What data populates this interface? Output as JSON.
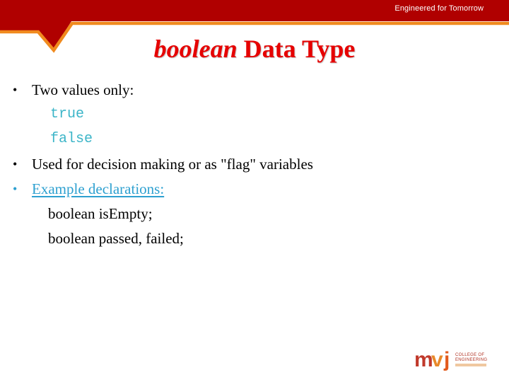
{
  "header": {
    "tagline": "Engineered for Tomorrow",
    "colors": {
      "banner_red": "#b00000",
      "accent_orange": "#f08a1e",
      "title_red": "#e60000"
    }
  },
  "slide": {
    "title_italic": "boolean",
    "title_rest": " Data Type",
    "items": [
      {
        "type": "bullet",
        "text": "Two values only:"
      },
      {
        "type": "code",
        "text": "true"
      },
      {
        "type": "code",
        "text": "false"
      },
      {
        "type": "bullet",
        "text": "Used for decision making or as \"flag\" variables"
      },
      {
        "type": "link-bullet",
        "text": "Example declarations:"
      },
      {
        "type": "indent",
        "text": "boolean isEmpty;"
      },
      {
        "type": "indent",
        "text": "boolean passed, failed;"
      }
    ],
    "bullet_glyph": "•"
  },
  "logo": {
    "m": "m",
    "v": "v",
    "j": "j",
    "line1": "COLLEGE OF",
    "line2": "ENGINEERING"
  }
}
